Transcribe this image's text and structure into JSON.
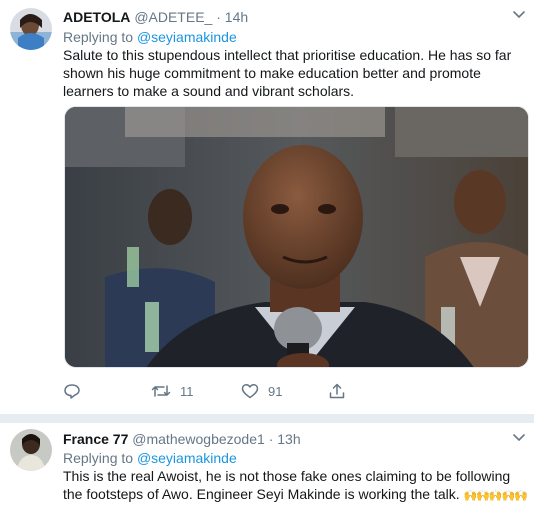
{
  "tweets": [
    {
      "author_name": "ADETOLA",
      "author_handle": "@ADETEE_",
      "separator": "·",
      "time": "14h",
      "replying_prefix": "Replying to",
      "replying_to": "@seyiamakinde",
      "text": "Salute to this stupendous intellect that prioritise education. He has so far shown his huge commitment to make education better and promote learners to make a sound and vibrant scholars.",
      "has_photo": true,
      "actions": {
        "reply_count": "",
        "retweet_count": "11",
        "like_count": "91"
      },
      "icons": [
        "chevron-down-icon",
        "reply-icon",
        "retweet-icon",
        "like-icon",
        "share-icon"
      ]
    },
    {
      "author_name": "France 77",
      "author_handle": "@mathewogbezode1",
      "separator": "·",
      "time": "13h",
      "replying_prefix": "Replying to",
      "replying_to": "@seyiamakinde",
      "text": "This is the real Awoist, he is not those fake ones claiming to be following the footsteps of Awo. Engineer Seyi Makinde is working the talk.",
      "emoji_trail": "🙌🙌🙌🙌🙌🙌🙌🙌",
      "icons": [
        "chevron-down-icon"
      ]
    }
  ],
  "colors": {
    "link": "#1b95e0",
    "muted": "#657786",
    "text": "#14171a",
    "divider": "#e6ecf0"
  }
}
